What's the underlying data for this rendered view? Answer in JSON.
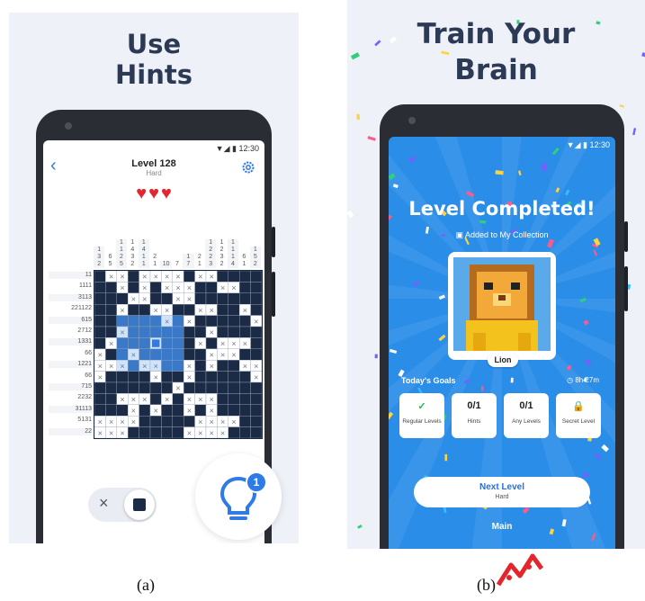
{
  "panel_a": {
    "headline": [
      "Use",
      "Hints"
    ],
    "status_time": "12:30",
    "level_title": "Level 128",
    "level_difficulty": "Hard",
    "hearts": 3,
    "icons": {
      "back": "chevron-left-icon",
      "settings": "gear-icon",
      "heart": "heart-icon",
      "hint": "lightbulb-icon",
      "toggle_cross": "cross-icon",
      "toggle_fill": "square-icon"
    },
    "column_clues": [
      [
        "1",
        "3",
        "2"
      ],
      [
        "6",
        "5"
      ],
      [
        "1",
        "1",
        "2",
        "5"
      ],
      [
        "1",
        "4",
        "3",
        "2"
      ],
      [
        "1",
        "4",
        "1",
        "1"
      ],
      [
        "2",
        "1"
      ],
      [
        "10"
      ],
      [
        "7"
      ],
      [
        "1",
        "7"
      ],
      [
        "2",
        "1"
      ],
      [
        "1",
        "2",
        "2",
        "3"
      ],
      [
        "1",
        "2",
        "3",
        "2"
      ],
      [
        "1",
        "1",
        "1",
        "4"
      ],
      [
        "6",
        "1"
      ],
      [
        "1",
        "5",
        "2"
      ]
    ],
    "row_clues": [
      "11",
      "1111",
      "3113",
      "221122",
      "615",
      "2712",
      "1331",
      "66",
      "1221",
      "66",
      "715",
      "2232",
      "31113",
      "5131",
      "22"
    ],
    "hint_count": "1",
    "toggle_cross_label": "×"
  },
  "panel_b": {
    "headline": [
      "Train Your",
      "Brain"
    ],
    "status_time": "12:30",
    "completed_title": "Level Completed!",
    "added_text": "Added to My Collection",
    "art_label": "Lion",
    "goals_title": "Today's Goals",
    "goals_timer": "8h 27m",
    "goals": [
      {
        "top": "✓",
        "label": "Regular Levels"
      },
      {
        "top": "0/1",
        "label": "Hints"
      },
      {
        "top": "0/1",
        "label": "Any Levels"
      },
      {
        "top": "🔒",
        "label": "Secret Level"
      }
    ],
    "next_button": "Next Level",
    "next_sub": "Hard",
    "main_link": "Main"
  },
  "captions": [
    "(a)",
    "(b)"
  ],
  "colors": {
    "cell_filled": "#1b2b45",
    "accent": "#2e7be6",
    "screen_blue": "#2a8de8",
    "heart": "#e3262f"
  }
}
